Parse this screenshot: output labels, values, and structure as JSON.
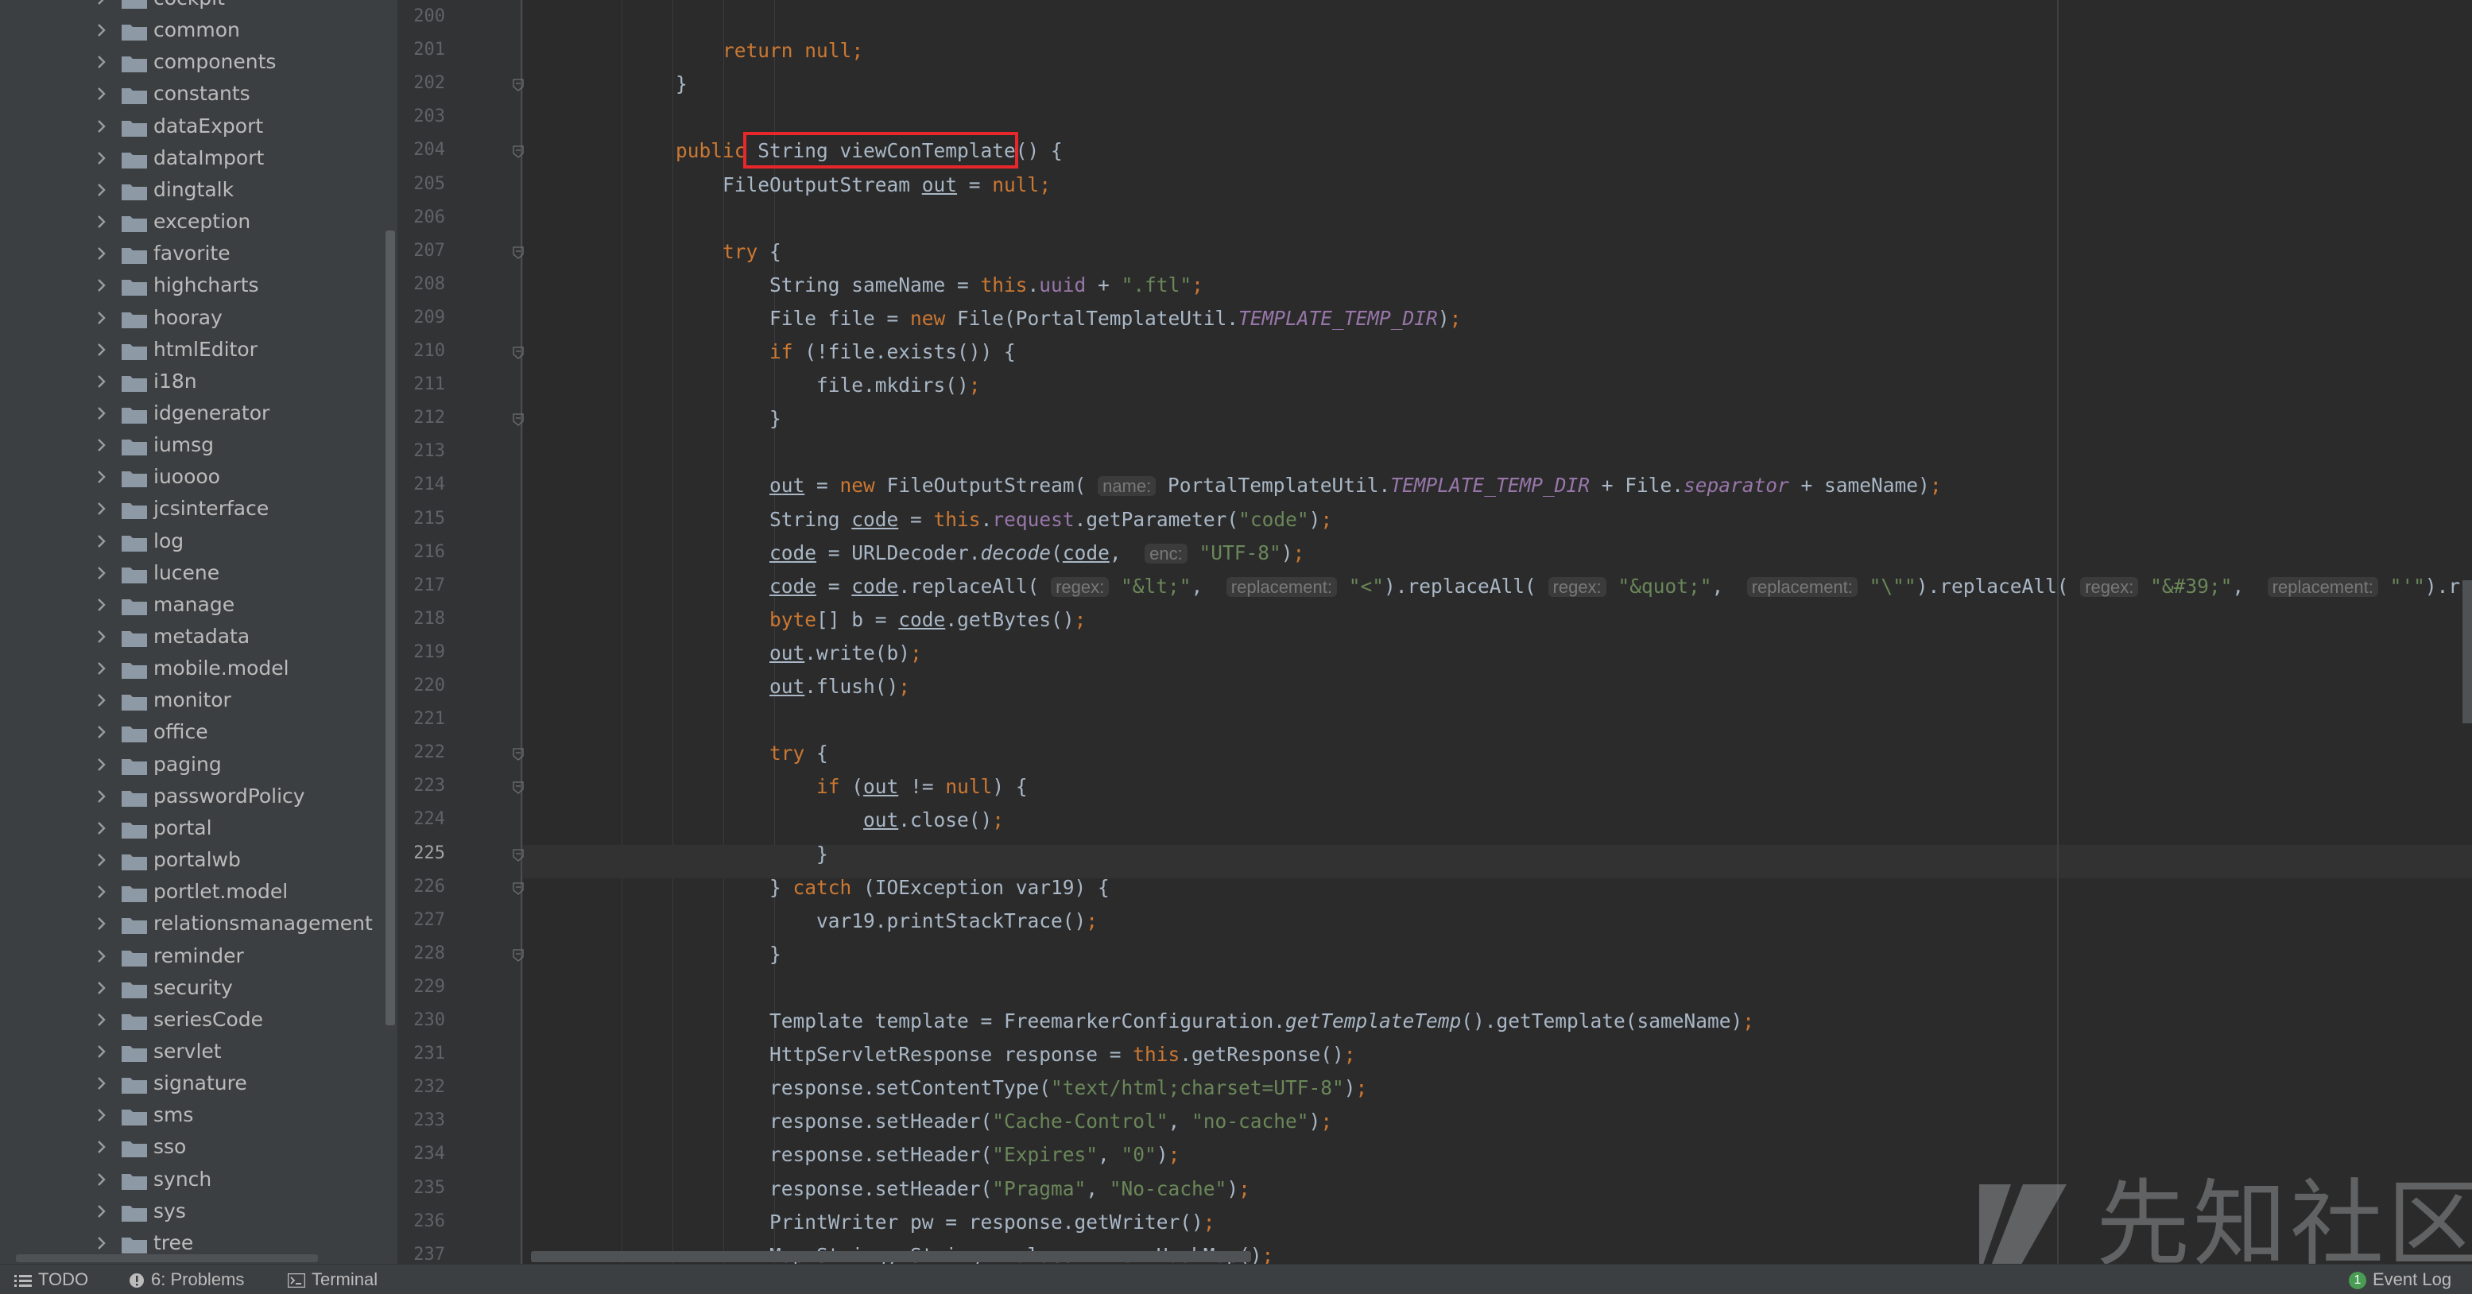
{
  "project_tree": {
    "items": [
      {
        "label": "cockpit"
      },
      {
        "label": "common"
      },
      {
        "label": "components"
      },
      {
        "label": "constants"
      },
      {
        "label": "dataExport"
      },
      {
        "label": "dataImport"
      },
      {
        "label": "dingtalk"
      },
      {
        "label": "exception"
      },
      {
        "label": "favorite"
      },
      {
        "label": "highcharts"
      },
      {
        "label": "hooray"
      },
      {
        "label": "htmlEditor"
      },
      {
        "label": "i18n"
      },
      {
        "label": "idgenerator"
      },
      {
        "label": "iumsg"
      },
      {
        "label": "iuoooo"
      },
      {
        "label": "jcsinterface"
      },
      {
        "label": "log"
      },
      {
        "label": "lucene"
      },
      {
        "label": "manage"
      },
      {
        "label": "metadata"
      },
      {
        "label": "mobile.model"
      },
      {
        "label": "monitor"
      },
      {
        "label": "office"
      },
      {
        "label": "paging"
      },
      {
        "label": "passwordPolicy"
      },
      {
        "label": "portal"
      },
      {
        "label": "portalwb"
      },
      {
        "label": "portlet.model"
      },
      {
        "label": "relationsmanagement"
      },
      {
        "label": "reminder"
      },
      {
        "label": "security"
      },
      {
        "label": "seriesCode"
      },
      {
        "label": "servlet"
      },
      {
        "label": "signature"
      },
      {
        "label": "sms"
      },
      {
        "label": "sso"
      },
      {
        "label": "synch"
      },
      {
        "label": "sys"
      },
      {
        "label": "tree"
      }
    ]
  },
  "editor": {
    "current_line": "225",
    "highlighted_token": "viewConTemplate() {",
    "lines": [
      {
        "n": "200",
        "t": ""
      },
      {
        "n": "201",
        "t": "            return null;"
      },
      {
        "n": "202",
        "t": "        }"
      },
      {
        "n": "203",
        "t": ""
      },
      {
        "n": "204",
        "t": "        public String viewConTemplate() {"
      },
      {
        "n": "205",
        "t": "            FileOutputStream out = null;"
      },
      {
        "n": "206",
        "t": ""
      },
      {
        "n": "207",
        "t": "            try {"
      },
      {
        "n": "208",
        "t": "                String sameName = this.uuid + \".ftl\";"
      },
      {
        "n": "209",
        "t": "                File file = new File(PortalTemplateUtil.TEMPLATE_TEMP_DIR);"
      },
      {
        "n": "210",
        "t": "                if (!file.exists()) {"
      },
      {
        "n": "211",
        "t": "                    file.mkdirs();"
      },
      {
        "n": "212",
        "t": "                }"
      },
      {
        "n": "213",
        "t": ""
      },
      {
        "n": "214",
        "t": "                out = new FileOutputStream( name: PortalTemplateUtil.TEMPLATE_TEMP_DIR + File.separator + sameName);"
      },
      {
        "n": "215",
        "t": "                String code = this.request.getParameter(\"code\");"
      },
      {
        "n": "216",
        "t": "                code = URLDecoder.decode(code,  enc: \"UTF-8\");"
      },
      {
        "n": "217",
        "t": "                code = code.replaceAll( regex: \"&lt;\",  replacement: \"<\").replaceAll( regex: \"&quot;\",  replacement: \"\\\"\").replaceAll( regex: \"&#39;\",  replacement: \"'\").r"
      },
      {
        "n": "218",
        "t": "                byte[] b = code.getBytes();"
      },
      {
        "n": "219",
        "t": "                out.write(b);"
      },
      {
        "n": "220",
        "t": "                out.flush();"
      },
      {
        "n": "221",
        "t": ""
      },
      {
        "n": "222",
        "t": "                try {"
      },
      {
        "n": "223",
        "t": "                    if (out != null) {"
      },
      {
        "n": "224",
        "t": "                        out.close();"
      },
      {
        "n": "225",
        "t": "                    }"
      },
      {
        "n": "226",
        "t": "                } catch (IOException var19) {"
      },
      {
        "n": "227",
        "t": "                    var19.printStackTrace();"
      },
      {
        "n": "228",
        "t": "                }"
      },
      {
        "n": "229",
        "t": ""
      },
      {
        "n": "230",
        "t": "                Template template = FreemarkerConfiguration.getTemplateTemp().getTemplate(sameName);"
      },
      {
        "n": "231",
        "t": "                HttpServletResponse response = this.getResponse();"
      },
      {
        "n": "232",
        "t": "                response.setContentType(\"text/html;charset=UTF-8\");"
      },
      {
        "n": "233",
        "t": "                response.setHeader(\"Cache-Control\", \"no-cache\");"
      },
      {
        "n": "234",
        "t": "                response.setHeader(\"Expires\", \"0\");"
      },
      {
        "n": "235",
        "t": "                response.setHeader(\"Pragma\", \"No-cache\");"
      },
      {
        "n": "236",
        "t": "                PrintWriter pw = response.getWriter();"
      },
      {
        "n": "237",
        "t": "                Map<String, String> values = new HashMap();"
      }
    ]
  },
  "watermark": {
    "text": "先知社区"
  },
  "statusbar": {
    "todo": "TODO",
    "problems": "6: Problems",
    "terminal": "Terminal",
    "event_log": "Event Log",
    "event_count": "1"
  },
  "colors": {
    "keyword": "#cc7832",
    "string": "#6a8759",
    "field": "#9876aa",
    "default_text": "#a9b7c6",
    "highlight_box": "#e8272b"
  }
}
